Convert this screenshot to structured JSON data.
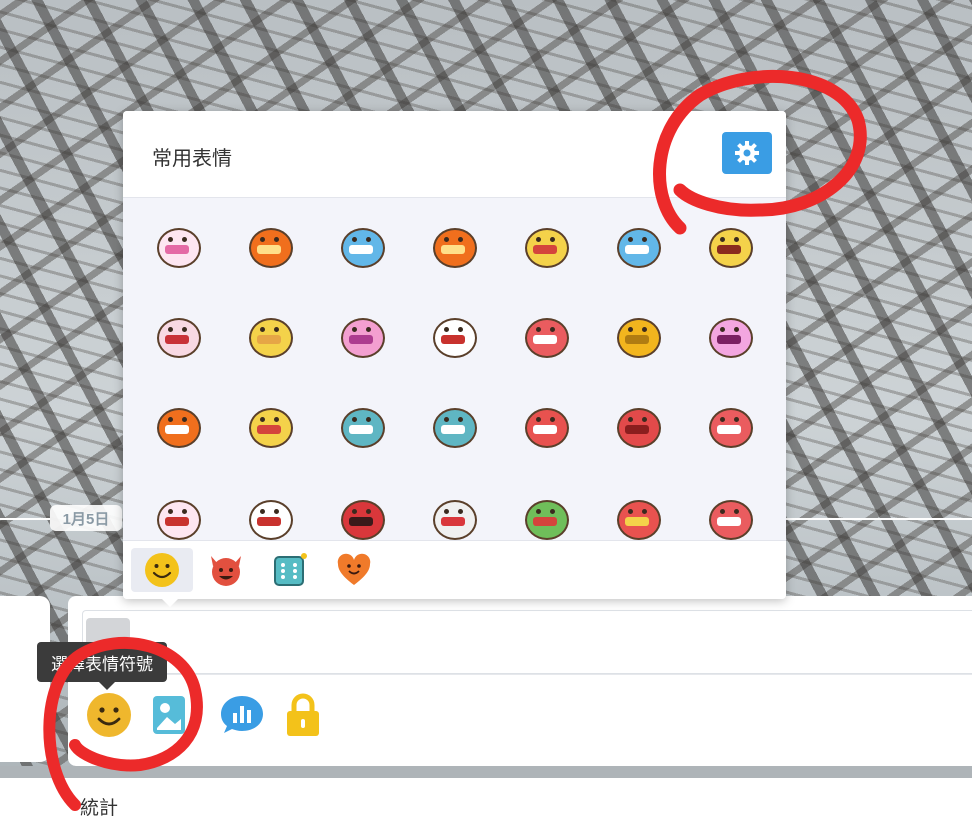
{
  "timeline": {
    "date_label": "1月5日"
  },
  "emoji_panel": {
    "title": "常用表情",
    "settings_icon": "gear-icon",
    "accent_color": "#3a9de4",
    "stickers": [
      {
        "name": "white-blush-face",
        "color": "#fde6f1",
        "mouth": "#e46aa5"
      },
      {
        "name": "orange-grin-face",
        "color": "#f06f1d",
        "mouth": "#ffe08a"
      },
      {
        "name": "blue-cat-face",
        "color": "#62b7e8",
        "mouth": "#ffffff"
      },
      {
        "name": "orange-grin-face-2",
        "color": "#f06f1d",
        "mouth": "#ffe08a"
      },
      {
        "name": "yellow-bird-laugh",
        "color": "#f4d24a",
        "mouth": "#d4443c"
      },
      {
        "name": "blue-cat-face-2",
        "color": "#62b7e8",
        "mouth": "#ffffff"
      },
      {
        "name": "yellow-bird-shout",
        "color": "#f4d24a",
        "mouth": "#8a2b1e"
      },
      {
        "name": "reindeer-laugh",
        "color": "#f8d9e3",
        "mouth": "#c83238"
      },
      {
        "name": "yellow-bird-closed",
        "color": "#f4d24a",
        "mouth": "#e6a646"
      },
      {
        "name": "pink-pig-face",
        "color": "#f39fd0",
        "mouth": "#ad3c8f"
      },
      {
        "name": "white-ghost-grin",
        "color": "#ffffff",
        "mouth": "#c8322e"
      },
      {
        "name": "red-robot-face",
        "color": "#ea5c5f",
        "mouth": "#ffffff"
      },
      {
        "name": "clock-face",
        "color": "#f2b51e",
        "mouth": "#b07c12"
      },
      {
        "name": "pink-pig-face-2",
        "color": "#f3a6e0",
        "mouth": "#7a2062"
      },
      {
        "name": "orange-grin-thumb",
        "color": "#f06f1d",
        "mouth": "#ffffff"
      },
      {
        "name": "yellow-eating-face",
        "color": "#f4d24a",
        "mouth": "#d4443c"
      },
      {
        "name": "teal-glasses-face",
        "color": "#5fb6c3",
        "mouth": "#ffffff"
      },
      {
        "name": "teal-grimace-face",
        "color": "#5fb6c3",
        "mouth": "#ffffff"
      },
      {
        "name": "red-blob-face",
        "color": "#e8524f",
        "mouth": "#ffffff"
      },
      {
        "name": "red-tomato-face",
        "color": "#e24a4a",
        "mouth": "#8a1e1e"
      },
      {
        "name": "red-robot-face-2",
        "color": "#ea5c5f",
        "mouth": "#ffffff"
      },
      {
        "name": "white-blush-laugh",
        "color": "#fde6f1",
        "mouth": "#c8322e"
      },
      {
        "name": "white-ghost-wave",
        "color": "#ffffff",
        "mouth": "#c8322e"
      },
      {
        "name": "red-singing-face",
        "color": "#d9373b",
        "mouth": "#3a1a1a"
      },
      {
        "name": "cursing-face",
        "color": "#f0f0f0",
        "mouth": "#d9373b"
      },
      {
        "name": "green-frog-face",
        "color": "#6fbe5a",
        "mouth": "#d4443c"
      },
      {
        "name": "red-cheers-face",
        "color": "#e8524f",
        "mouth": "#f4d24a"
      },
      {
        "name": "red-robot-face-3",
        "color": "#ea5c5f",
        "mouth": "#ffffff"
      }
    ],
    "categories": [
      {
        "name": "smile-tab-icon",
        "active": true
      },
      {
        "name": "devil-tab-icon",
        "active": false
      },
      {
        "name": "dice-tab-icon",
        "active": false
      },
      {
        "name": "heart-tab-icon",
        "active": false
      }
    ]
  },
  "composer": {
    "tooltip": "選擇表情符號",
    "tools": [
      {
        "name": "emoji-icon"
      },
      {
        "name": "image-icon"
      },
      {
        "name": "chart-icon"
      },
      {
        "name": "lock-icon"
      }
    ]
  },
  "bottom": {
    "stats_label": "統計"
  }
}
